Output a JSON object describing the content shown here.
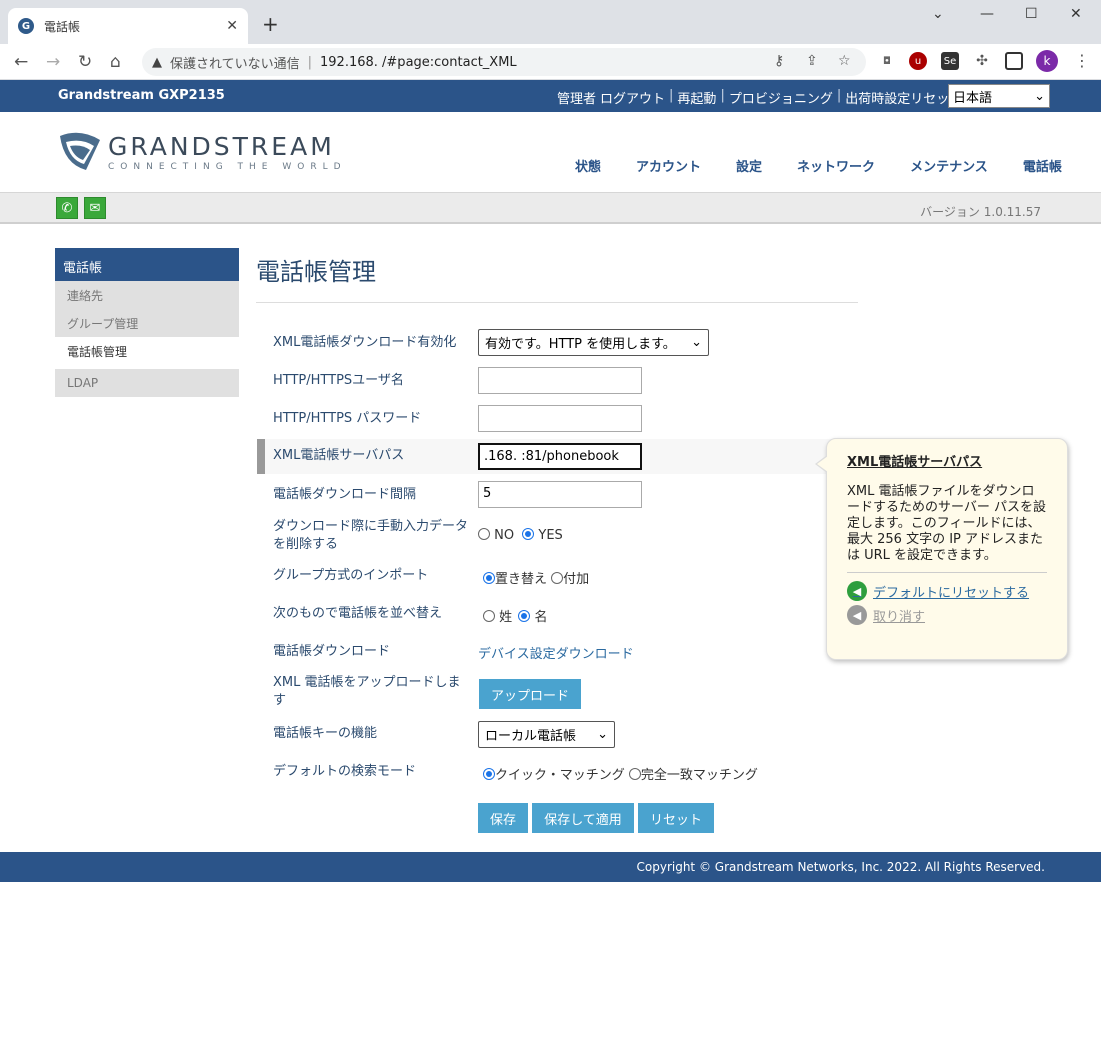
{
  "browser": {
    "tab_title": "電話帳",
    "security_text": "保護されていない通信",
    "url": "192.168.        /#page:contact_XML",
    "profile_initial": "k"
  },
  "topbar": {
    "model": "Grandstream GXP2135",
    "links": [
      "管理者",
      "ログアウト",
      "再起動",
      "プロビジョニング",
      "出荷時設定リセット"
    ],
    "language": "日本語"
  },
  "logo": {
    "name": "GRANDSTREAM",
    "tagline": "CONNECTING THE WORLD"
  },
  "nav": [
    "状態",
    "アカウント",
    "設定",
    "ネットワーク",
    "メンテナンス",
    "電話帳"
  ],
  "version": "バージョン 1.0.11.57",
  "sidebar": {
    "header": "電話帳",
    "items": [
      "連絡先",
      "グループ管理",
      "電話帳管理",
      "LDAP"
    ]
  },
  "page": {
    "title": "電話帳管理"
  },
  "form": {
    "xml_enable": {
      "label": "XML電話帳ダウンロード有効化",
      "value": "有効です。HTTP を使用します。"
    },
    "http_user": {
      "label": "HTTP/HTTPSユーザ名",
      "value": ""
    },
    "http_pass": {
      "label": "HTTP/HTTPS パスワード",
      "value": ""
    },
    "server_path": {
      "label": "XML電話帳サーバパス",
      "value": ".168.          :81/phonebook"
    },
    "interval": {
      "label": "電話帳ダウンロード間隔",
      "value": "5"
    },
    "remove_manual": {
      "label": "ダウンロード際に手動入力データを削除する",
      "opt_no": "NO",
      "opt_yes": "YES"
    },
    "group_import": {
      "label": "グループ方式のインポート",
      "opt_replace": "置き替え",
      "opt_append": "付加"
    },
    "sort": {
      "label": "次のもので電話帳を並べ替え",
      "opt_last": "姓",
      "opt_first": "名"
    },
    "download": {
      "label": "電話帳ダウンロード",
      "link": "デバイス設定ダウンロード"
    },
    "upload": {
      "label": "XML 電話帳をアップロードします",
      "button": "アップロード"
    },
    "key_func": {
      "label": "電話帳キーの機能",
      "value": "ローカル電話帳"
    },
    "search_mode": {
      "label": "デフォルトの検索モード",
      "opt_quick": "クイック・マッチング",
      "opt_exact": "完全一致マッチング"
    }
  },
  "buttons": {
    "save": "保存",
    "save_apply": "保存して適用",
    "reset": "リセット"
  },
  "tooltip": {
    "title": "XML電話帳サーバパス",
    "body": "XML 電話帳ファイルをダウンロードするためのサーバー パスを設定します。このフィールドには、最大 256 文字の IP アドレスまたは URL を設定できます。",
    "reset_default": "デフォルトにリセットする",
    "undo": "取り消す"
  },
  "footer": "Copyright © Grandstream Networks, Inc. 2022. All Rights Reserved.",
  "colors": {
    "brand_blue": "#2b5489",
    "button_blue": "#4aa3cf",
    "icon_green": "#3aa83a"
  }
}
